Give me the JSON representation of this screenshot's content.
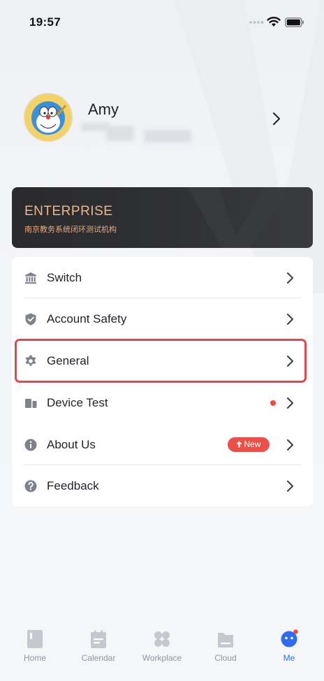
{
  "status_bar": {
    "time": "19:57"
  },
  "profile": {
    "name": "Amy"
  },
  "enterprise": {
    "title": "ENTERPRISE",
    "org_name": "南京教务系统闭环测试机构"
  },
  "menu": {
    "items": [
      {
        "label": "Switch",
        "icon": "bank-icon"
      },
      {
        "label": "Account Safety",
        "icon": "shield-icon"
      },
      {
        "label": "General",
        "icon": "gear-icon"
      },
      {
        "label": "Device Test",
        "icon": "device-icon",
        "has_dot": true
      },
      {
        "label": "About Us",
        "icon": "info-icon",
        "badge": "New"
      },
      {
        "label": "Feedback",
        "icon": "question-icon"
      }
    ]
  },
  "tab_bar": {
    "tabs": [
      {
        "label": "Home",
        "active": false
      },
      {
        "label": "Calendar",
        "active": false
      },
      {
        "label": "Workplace",
        "active": false
      },
      {
        "label": "Cloud",
        "active": false
      },
      {
        "label": "Me",
        "active": true
      }
    ]
  },
  "colors": {
    "accent": "#2f6cf4",
    "enterprise_text": "#f0b38f",
    "badge_red": "#e9504a",
    "highlight_red": "#e5464b"
  }
}
